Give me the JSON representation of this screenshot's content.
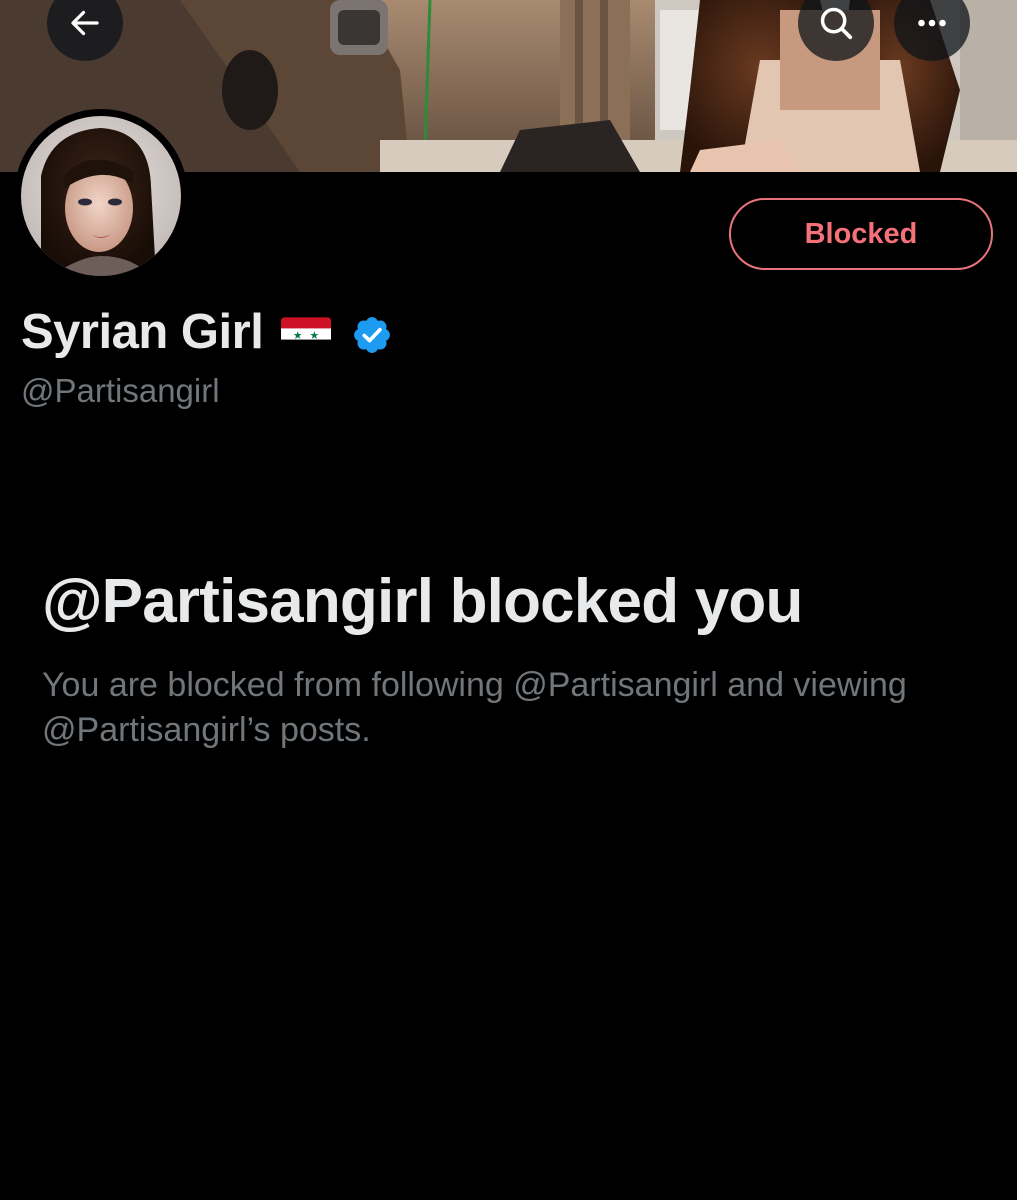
{
  "header": {
    "back_icon": "arrow-left-icon",
    "search_icon": "search-icon",
    "more_icon": "more-horizontal-icon"
  },
  "profile": {
    "display_name": "Syrian Girl",
    "flag_emoji": "🇸🇾",
    "verified_icon": "verified-badge-icon",
    "handle": "@Partisangirl",
    "blocked_button_label": "Blocked"
  },
  "blocked_notice": {
    "title": "@Partisangirl blocked you",
    "description": "You are blocked from following @Partisangirl and viewing @Partisangirl’s posts."
  },
  "colors": {
    "background": "#000000",
    "primary_text": "#e7e9ea",
    "secondary_text": "#71767b",
    "blocked_red": "#f4717a",
    "verified_blue": "#1d9bf0"
  }
}
